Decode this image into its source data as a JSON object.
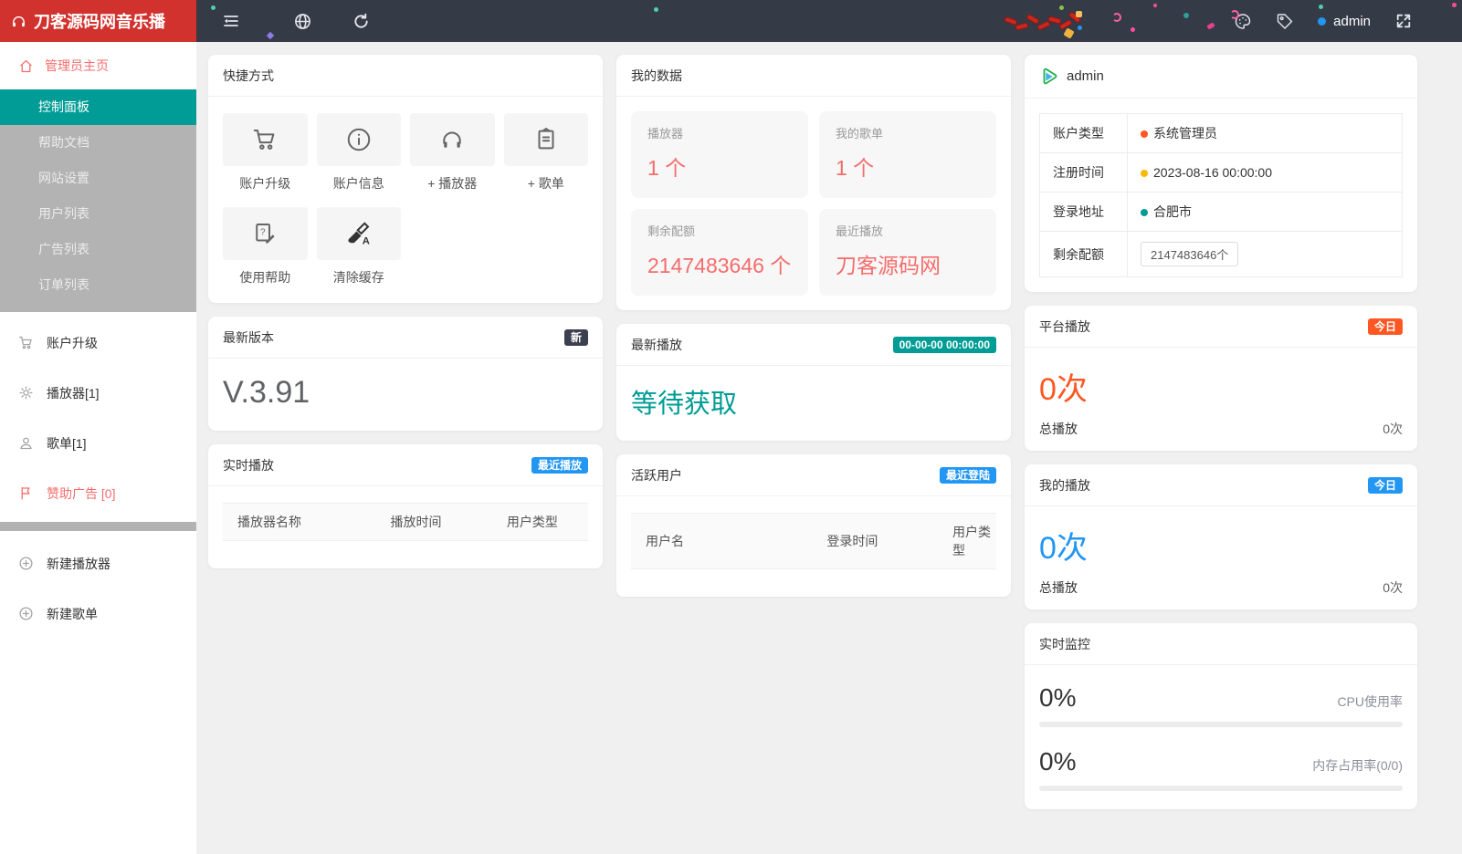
{
  "navbar": {
    "brand": "刀客源码网音乐播",
    "username": "admin",
    "icons": {
      "brand": "headphones-icon",
      "collapse": "menu-fold-icon",
      "locale": "globe-icon",
      "refresh": "refresh-icon",
      "theme": "palette-icon",
      "tag": "tag-icon",
      "fullscreen": "fullscreen-icon"
    }
  },
  "sidebar": {
    "home": {
      "label": "管理员主页",
      "icon": "home-icon"
    },
    "submenu": [
      {
        "label": "控制面板",
        "active": true
      },
      {
        "label": "帮助文档",
        "active": false
      },
      {
        "label": "网站设置",
        "active": false
      },
      {
        "label": "用户列表",
        "active": false
      },
      {
        "label": "广告列表",
        "active": false
      },
      {
        "label": "订单列表",
        "active": false
      }
    ],
    "menu": [
      {
        "label": "账户升级",
        "icon": "cart-icon"
      },
      {
        "label": "播放器[1]",
        "icon": "gear-icon"
      },
      {
        "label": "歌单[1]",
        "icon": "user-icon"
      },
      {
        "label": "赞助广告 [0]",
        "icon": "flag-icon"
      }
    ],
    "actions": [
      {
        "label": "新建播放器",
        "icon": "plus-circle-icon"
      },
      {
        "label": "新建歌单",
        "icon": "plus-circle-icon"
      }
    ]
  },
  "cards": {
    "shortcuts": {
      "title": "快捷方式",
      "items": [
        {
          "label": "账户升级",
          "icon": "cart-icon"
        },
        {
          "label": "账户信息",
          "icon": "info-circle-icon"
        },
        {
          "label": "+ 播放器",
          "icon": "headphones-icon"
        },
        {
          "label": "+ 歌单",
          "icon": "clipboard-icon"
        },
        {
          "label": "使用帮助",
          "icon": "help-doc-icon"
        },
        {
          "label": "清除缓存",
          "icon": "brush-icon"
        }
      ]
    },
    "my_data": {
      "title": "我的数据",
      "stats": [
        {
          "label": "播放器",
          "value": "1 个"
        },
        {
          "label": "我的歌单",
          "value": "1 个"
        },
        {
          "label": "剩余配额",
          "value": "2147483646 个"
        },
        {
          "label": "最近播放",
          "value": "刀客源码网"
        }
      ]
    },
    "profile": {
      "username": "admin",
      "avatar_icon": "play-logo-icon",
      "rows": [
        {
          "label": "账户类型",
          "value": "系统管理员",
          "dot_color": "#ff5722"
        },
        {
          "label": "注册时间",
          "value": "2023-08-16 00:00:00",
          "dot_color": "#ffb800"
        },
        {
          "label": "登录地址",
          "value": "合肥市",
          "dot_color": "#009c95"
        },
        {
          "label": "剩余配额",
          "value": "2147483646个",
          "boxed": true
        }
      ]
    },
    "version": {
      "title": "最新版本",
      "badge": "新",
      "value": "V.3.91"
    },
    "latest_play": {
      "title": "最新播放",
      "badge": "00-00-00 00:00:00",
      "value": "等待获取"
    },
    "platform_play": {
      "title": "平台播放",
      "badge": "今日",
      "value": "0次",
      "footer_label": "总播放",
      "footer_value": "0次"
    },
    "my_play": {
      "title": "我的播放",
      "badge": "今日",
      "value": "0次",
      "footer_label": "总播放",
      "footer_value": "0次"
    },
    "realtime_play": {
      "title": "实时播放",
      "badge": "最近播放",
      "headers": [
        "播放器名称",
        "播放时间",
        "用户类型"
      ],
      "rows": []
    },
    "active_users": {
      "title": "活跃用户",
      "badge": "最近登陆",
      "headers": [
        "用户名",
        "登录时间",
        "用户类型"
      ],
      "rows": []
    },
    "monitor": {
      "title": "实时监控",
      "items": [
        {
          "value": "0%",
          "label": "CPU使用率",
          "progress": 0
        },
        {
          "value": "0%",
          "label": "内存占用率(0/0)",
          "progress": 0
        }
      ]
    }
  },
  "colors": {
    "brand_red": "#d2322d",
    "navbar_bg": "#353a47",
    "accent_teal": "#009c95",
    "danger_red": "#f56c6c",
    "orange": "#ff5722",
    "blue": "#2196f3",
    "submenu_gray": "#b3b3b3"
  }
}
